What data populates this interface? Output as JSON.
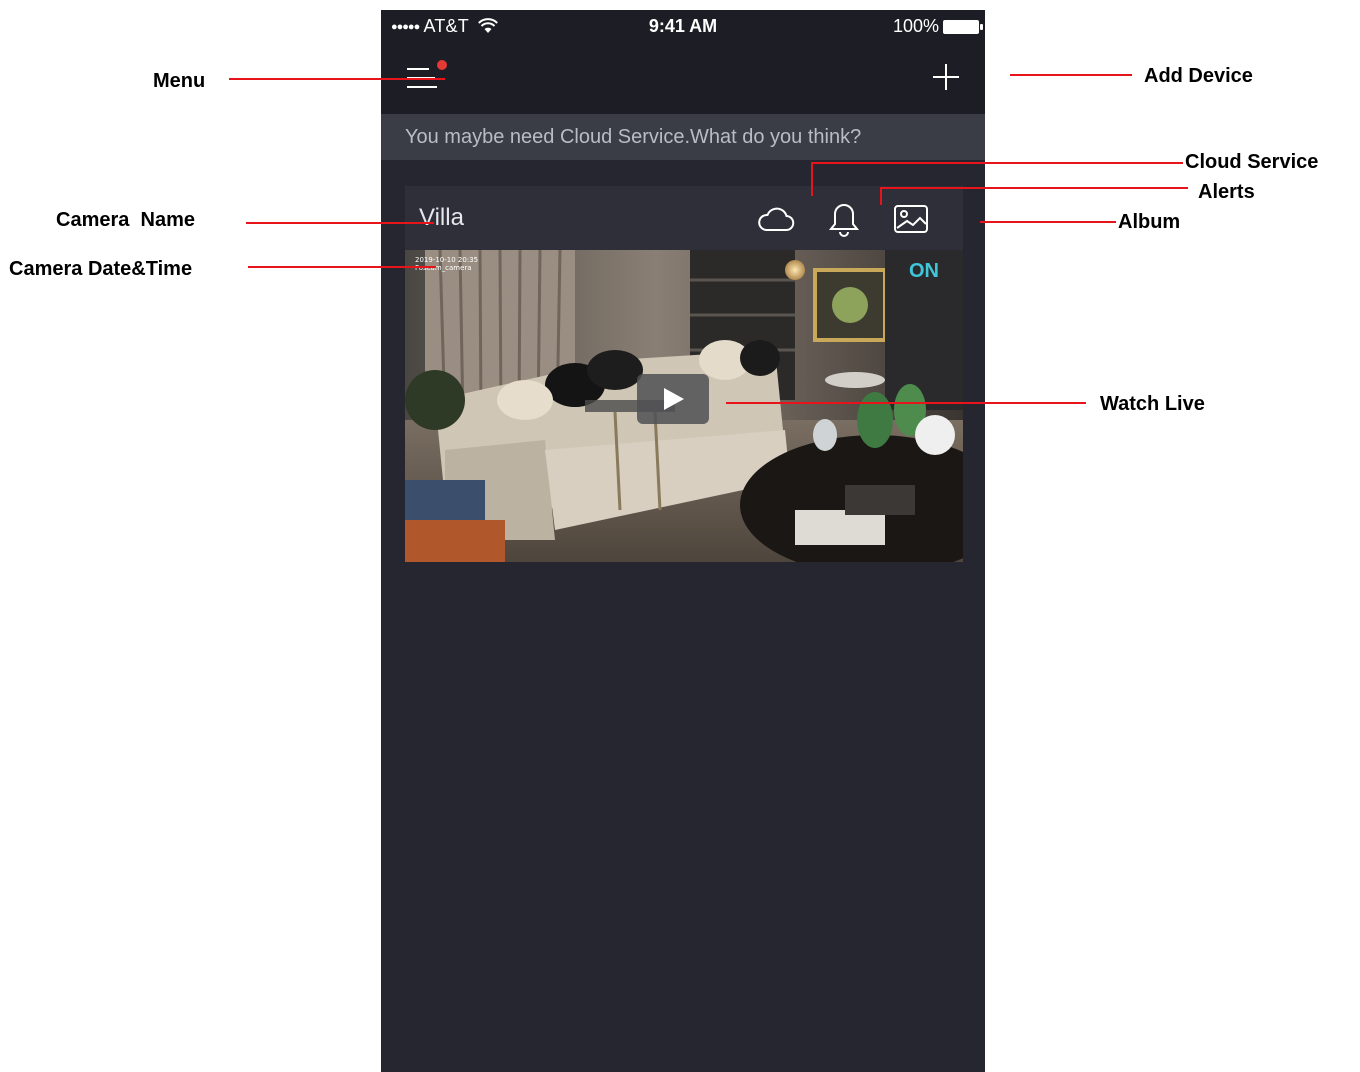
{
  "status_bar": {
    "signal_dots": "●●●●●",
    "carrier": "AT&T",
    "time": "9:41 AM",
    "battery": "100%"
  },
  "nav": {
    "menu_icon": "hamburger-menu-icon",
    "notification_dot_color": "#e53935",
    "add_icon": "plus-icon"
  },
  "banner": {
    "text": "You maybe need Cloud Service.What do you think?"
  },
  "camera_card": {
    "name": "Villa",
    "icons": [
      "cloud-icon",
      "bell-icon",
      "album-icon"
    ],
    "osd_date_time": "2019-10-10  20:35",
    "osd_camera_label": "Foscam_camera",
    "on_badge": "ON",
    "play_icon": "play-icon"
  },
  "annotations": {
    "menu": "Menu",
    "add_device": "Add Device",
    "cloud_service": "Cloud Service",
    "alerts": "Alerts",
    "album": "Album",
    "camera_name_part1": "Camera",
    "camera_name_part2": "Name",
    "camera_datetime_part1": "Camera",
    "camera_datetime_part2": "Date&Time",
    "watch_live": "Watch Live"
  },
  "colors": {
    "annotation_line": "#e8141c",
    "app_background": "#25262f",
    "accent_on": "#3fc6d8"
  }
}
